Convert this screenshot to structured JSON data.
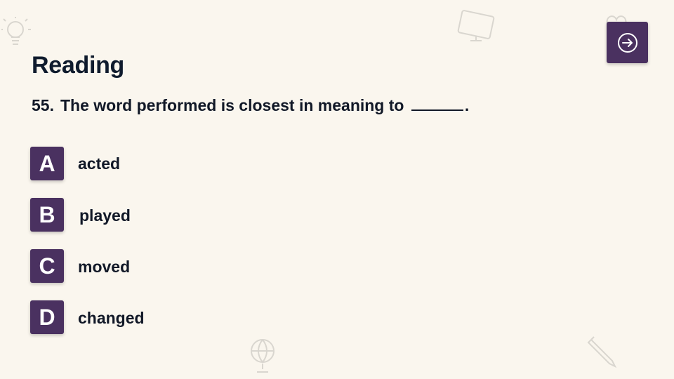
{
  "slide": {
    "title": "Reading",
    "question": {
      "number": "55.",
      "text": "The word performed is closest in meaning to",
      "end": "."
    },
    "options": [
      {
        "letter": "A",
        "text": "acted"
      },
      {
        "letter": "B",
        "text": "played"
      },
      {
        "letter": "C",
        "text": "moved"
      },
      {
        "letter": "D",
        "text": "changed"
      }
    ]
  },
  "navigation": {
    "next_icon": "arrow-right-circle-icon"
  },
  "decorations": [
    "lightbulb-icon",
    "computer-monitor-icon",
    "heart-icon",
    "globe-icon",
    "pencil-icon"
  ],
  "colors": {
    "background": "#faf6ee",
    "accent": "#4a3160",
    "text": "#0f1b2d"
  }
}
